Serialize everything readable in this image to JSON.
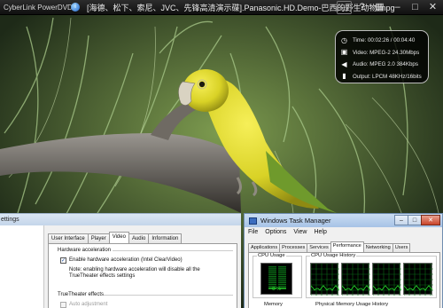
{
  "titlebar": {
    "app_name": "CyberLink PowerDVD",
    "info_icon": "i",
    "file_name": "[海德、松下、索尼、JVC、先锋高清演示碟].Panasonic.HD.Demo-巴西的野生动物.mpg",
    "buttons": [
      "mini-player-icon",
      "help-icon",
      "skin-icon",
      "minimize-icon",
      "maximize-icon",
      "close-icon"
    ]
  },
  "overlay": {
    "rows": [
      {
        "icon": "clock-icon",
        "text": "Time: 00:02:26 / 00:04:40"
      },
      {
        "icon": "video-icon",
        "text": "Video: MPEG-2  24.30Mbps"
      },
      {
        "icon": "speaker-icon",
        "text": "Audio: MPEG 2.0   384Kbps"
      },
      {
        "icon": "output-icon",
        "text": "Output: LPCM 48KHz/16bits"
      }
    ]
  },
  "settings": {
    "title": "ettings",
    "tabs": [
      "User Interface",
      "Player",
      "Video",
      "Audio",
      "Information"
    ],
    "active_tab": "Video",
    "hw_group": "Hardware acceleration",
    "hw_checkbox_label": "Enable hardware acceleration (Intel ClearVideo)",
    "hw_checked": true,
    "note": "Note: enabling hardware acceleration will disable all the TrueTheater effects settings",
    "tt_group": "TrueTheater effects",
    "auto_adjust_label": "Auto adjustment"
  },
  "taskmgr": {
    "title": "Windows Task Manager",
    "menu": [
      "File",
      "Options",
      "View",
      "Help"
    ],
    "tabs": [
      "Applications",
      "Processes",
      "Services",
      "Performance",
      "Networking",
      "Users"
    ],
    "active_tab": "Performance",
    "cpu_usage_label": "CPU Usage",
    "cpu_history_label": "CPU Usage History",
    "cpu_value": "8 %",
    "cpu_fraction": 0.08,
    "memory_label": "Memory",
    "physical_memory_label": "Physical Memory Usage History",
    "colors": {
      "graph_bg": "#000000",
      "graph_grid": "#0b6b16",
      "graph_line": "#27e02d"
    }
  }
}
